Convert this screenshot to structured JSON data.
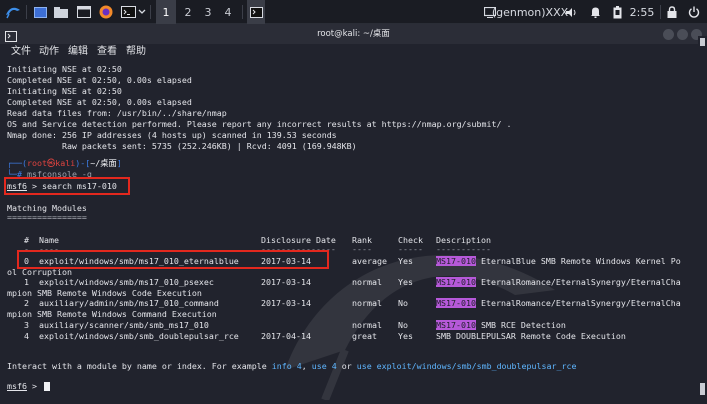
{
  "taskbar": {
    "workspaces": [
      "1",
      "2",
      "3",
      "4"
    ],
    "active_workspace": "1",
    "genmon_label": "(genmon)XXX",
    "clock": "2:55",
    "icons": [
      "kali-menu-icon",
      "window-icon",
      "folder-icon",
      "browser-icon",
      "firefox-icon",
      "terminal-icon",
      "chevron-down-icon",
      "terminal-task-icon",
      "monitor-icon",
      "volume-icon",
      "bell-icon",
      "battery-icon",
      "lock-icon",
      "power-icon"
    ]
  },
  "window": {
    "title": "root@kali: ~/桌面",
    "menu": [
      "文件",
      "动作",
      "编辑",
      "查看",
      "帮助"
    ]
  },
  "terminal": {
    "output_lines": [
      "Initiating NSE at 02:50",
      "Completed NSE at 02:50, 0.00s elapsed",
      "Initiating NSE at 02:50",
      "Completed NSE at 02:50, 0.00s elapsed",
      "Read data files from: /usr/bin/../share/nmap",
      "OS and Service detection performed. Please report any incorrect results at https://nmap.org/submit/ .",
      "Nmap done: 256 IP addresses (4 hosts up) scanned in 139.53 seconds",
      "           Raw packets sent: 5735 (252.246KB) | Rcvd: 4091 (169.948KB)"
    ],
    "prompt": {
      "open": "┌──(",
      "user": "root",
      "at": "㉿",
      "host": "kali",
      "mid": ")-[",
      "dir": "~/桌面",
      "close": "]",
      "cmd_prefix": "└─# ",
      "cmd": "msfconsole -q"
    },
    "msf_prompt": "msf6",
    "search_command": " > search ms17-010",
    "matching_title": "Matching Modules",
    "matching_underline": "================",
    "headers": {
      "num": "#",
      "name": "Name",
      "date": "Disclosure Date",
      "rank": "Rank",
      "check": "Check",
      "desc": "Description"
    },
    "header_underlines": {
      "num": "-",
      "name": "----",
      "date": "---------------",
      "rank": "----",
      "check": "-----",
      "desc": "-----------"
    },
    "rows": [
      {
        "num": "0",
        "name": "exploit/windows/smb/ms17_010_eternalblue",
        "date": "2017-03-14",
        "rank": "average",
        "check": "Yes",
        "hl": "MS17-010",
        "desc": " EternalBlue SMB Remote Windows Kernel Po",
        "wrap": "ol Corruption"
      },
      {
        "num": "1",
        "name": "exploit/windows/smb/ms17_010_psexec",
        "date": "2017-03-14",
        "rank": "normal",
        "check": "Yes",
        "hl": "MS17-010",
        "desc": " EternalRomance/EternalSynergy/EternalCha",
        "wrap": "mpion SMB Remote Windows Code Execution"
      },
      {
        "num": "2",
        "name": "auxiliary/admin/smb/ms17_010_command",
        "date": "2017-03-14",
        "rank": "normal",
        "check": "No",
        "hl": "MS17-010",
        "desc": " EternalRomance/EternalSynergy/EternalCha",
        "wrap": "mpion SMB Remote Windows Command Execution"
      },
      {
        "num": "3",
        "name": "auxiliary/scanner/smb/smb_ms17_010",
        "date": "",
        "rank": "normal",
        "check": "No",
        "hl": "MS17-010",
        "desc": " SMB RCE Detection",
        "wrap": ""
      },
      {
        "num": "4",
        "name": "exploit/windows/smb/smb_doublepulsar_rce",
        "date": "2017-04-14",
        "rank": "great",
        "check": "Yes",
        "hl": "",
        "desc": "SMB DOUBLEPULSAR Remote Code Execution",
        "wrap": ""
      }
    ],
    "interact_text": "Interact with a module by name or index. For example ",
    "interact_info": "info 4",
    "interact_comma": ", ",
    "interact_use": "use 4",
    "interact_or": " or ",
    "interact_use_full": "use exploit/windows/smb/smb_doublepulsar_rce",
    "final_prompt_suffix": " > "
  }
}
